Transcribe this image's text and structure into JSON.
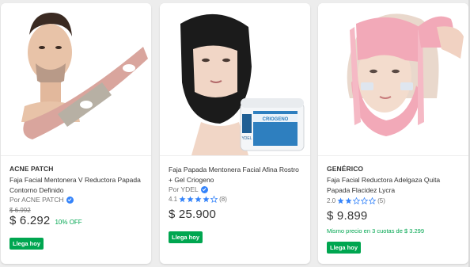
{
  "products": [
    {
      "brand": "ACNE PATCH",
      "title": "Faja Facial Mentonera V Reductora Papada Contorno Definido",
      "seller": "Por ACNE PATCH",
      "old_price": "$ 6.992",
      "price": "$ 6.292",
      "discount": "10% OFF",
      "badge": "Llega hoy"
    },
    {
      "title": "Faja Papada Mentonera Facial Afina Rostro + Gel Criogeno",
      "seller": "Por YDEL",
      "rating": "4.1",
      "rating_stars": 4,
      "reviews": "(8)",
      "price": "$ 25.900",
      "badge": "Llega hoy",
      "jar_label": "CRIOGENO",
      "jar_brand": "YDEL"
    },
    {
      "brand": "GENÉRICO",
      "title": "Faja Facial Reductora Adelgaza Quita Papada Flacidez Lycra",
      "rating": "2.0",
      "rating_stars": 2,
      "reviews": "(5)",
      "price": "$ 9.899",
      "installments": "Mismo precio en 3 cuotas de $ 3.299",
      "badge": "Llega hoy"
    }
  ],
  "colors": {
    "accent_green": "#00a650",
    "verified_blue": "#3483fa",
    "star_blue": "#3483fa"
  }
}
